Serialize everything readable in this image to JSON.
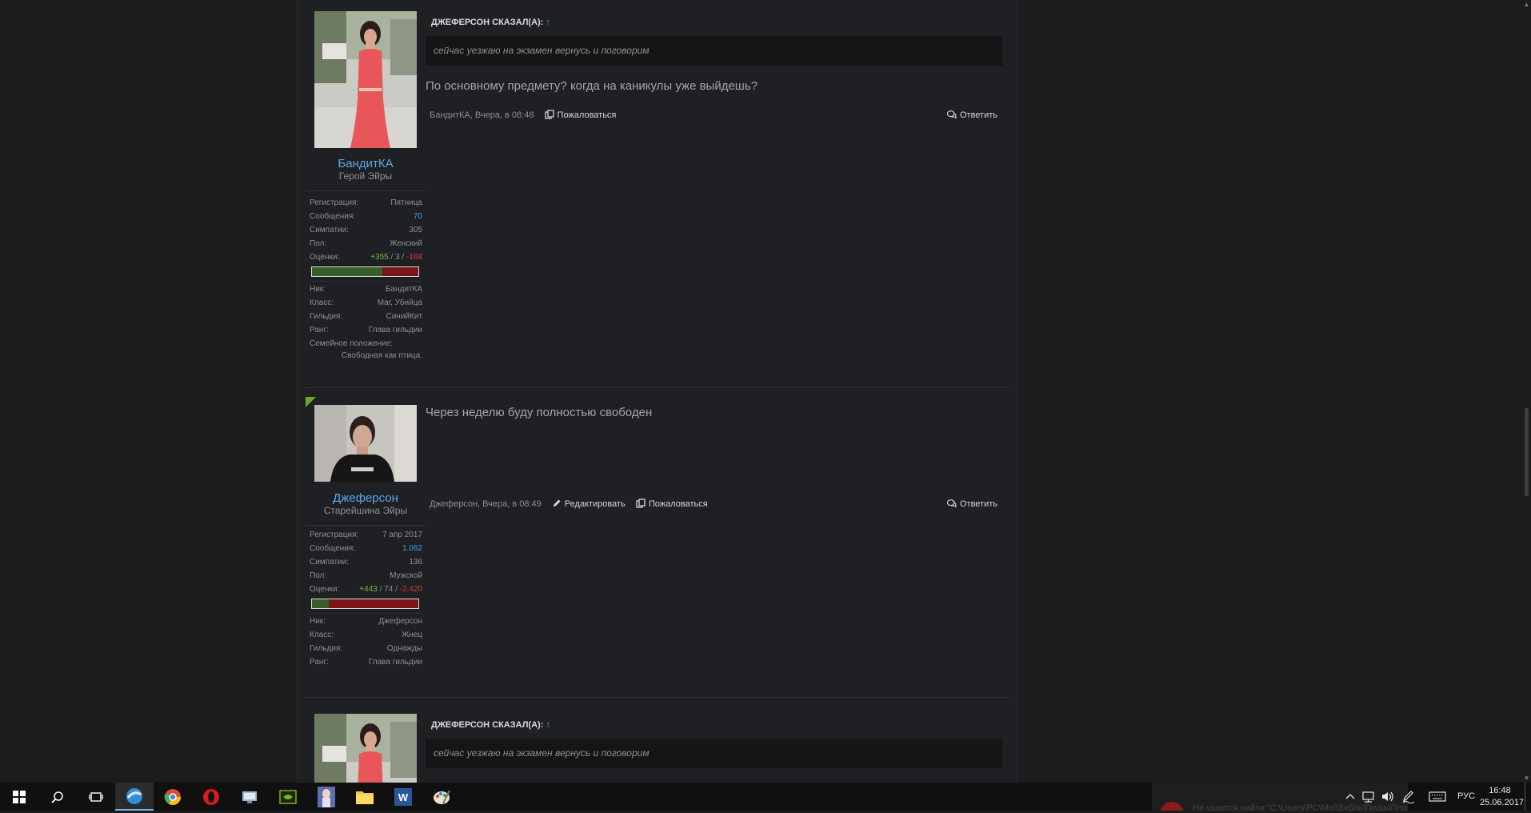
{
  "posts": [
    {
      "quote": {
        "header": "ДЖЕФЕРСОН СКАЗАЛ(А):",
        "arrow": "↑",
        "text": "сейчас уезжаю на экзамен вернусь и поговорим"
      },
      "message": "По основному предмету? когда на каникулы уже выйдешь?",
      "author": "БандитКА",
      "user_title": "Герой Эйры",
      "stats": [
        {
          "k": "Регистрация:",
          "v": "Пятница"
        },
        {
          "k": "Сообщения:",
          "v": "70"
        },
        {
          "k": "Симпатии:",
          "v": "305"
        },
        {
          "k": "Пол:",
          "v": "Женский"
        }
      ],
      "ratings": {
        "label": "Оценки:",
        "pos": "+355",
        "neutral": "3",
        "neg": "-168",
        "positive_fraction": 0.66
      },
      "profile": [
        {
          "k": "Ник:",
          "v": "БандитКА"
        },
        {
          "k": "Класс:",
          "v": "Маг, Убийца"
        },
        {
          "k": "Гильдия:",
          "v": "СинийКит"
        },
        {
          "k": "Ранг:",
          "v": "Глава гильдии"
        }
      ],
      "family": {
        "k": "Семейное положение:",
        "v": "Свободная как птица."
      },
      "meta": {
        "byline": "БандитКА, Вчера, в 08:48",
        "report": "Пожаловаться",
        "reply": "Ответить"
      }
    },
    {
      "message": "Через неделю буду полностью свободен",
      "author": "Джеферсон",
      "user_title": "Старейшина Эйры",
      "stats": [
        {
          "k": "Регистрация:",
          "v": "7 апр 2017"
        },
        {
          "k": "Сообщения:",
          "v": "1.062"
        },
        {
          "k": "Симпатии:",
          "v": "136"
        },
        {
          "k": "Пол:",
          "v": "Мужской"
        }
      ],
      "ratings": {
        "label": "Оценки:",
        "pos": "+443",
        "neutral": "74",
        "neg": "-2.420",
        "positive_fraction": 0.16
      },
      "profile": [
        {
          "k": "Ник:",
          "v": "Джеферсон"
        },
        {
          "k": "Класс:",
          "v": "Жнец"
        },
        {
          "k": "Гильдия:",
          "v": "Однажды"
        },
        {
          "k": "Ранг:",
          "v": "Глава гильдии"
        }
      ],
      "meta": {
        "byline": "Джеферсон, Вчера, в 08:49",
        "edit": "Редактировать",
        "report": "Пожаловаться",
        "reply": "Ответить"
      }
    },
    {
      "quote": {
        "header": "ДЖЕФЕРСОН СКАЗАЛ(А):",
        "arrow": "↑",
        "text": "сейчас уезжаю на экзамен вернусь и поговорим"
      }
    }
  ],
  "taskbar": {
    "apps": [
      "start-icon",
      "search-icon",
      "task-view-icon",
      "browser-icon",
      "chrome-icon",
      "opera-icon",
      "control-panel-icon",
      "nvidia-icon",
      "game-icon",
      "file-explorer-icon",
      "word-icon",
      "paint-icon"
    ],
    "lang": "РУС",
    "time": "16:48",
    "date": "25.06.2017",
    "notification": "Не удается найти \"C:\\Users\\PC\\Moi\\Дубль\\Грудь\\Пловчиха\""
  },
  "colors": {
    "accent": "#5aa8e8",
    "link": "#3da2e6",
    "positive": "#72b83d",
    "negative": "#d43a3a",
    "corner": "#6aa824"
  }
}
